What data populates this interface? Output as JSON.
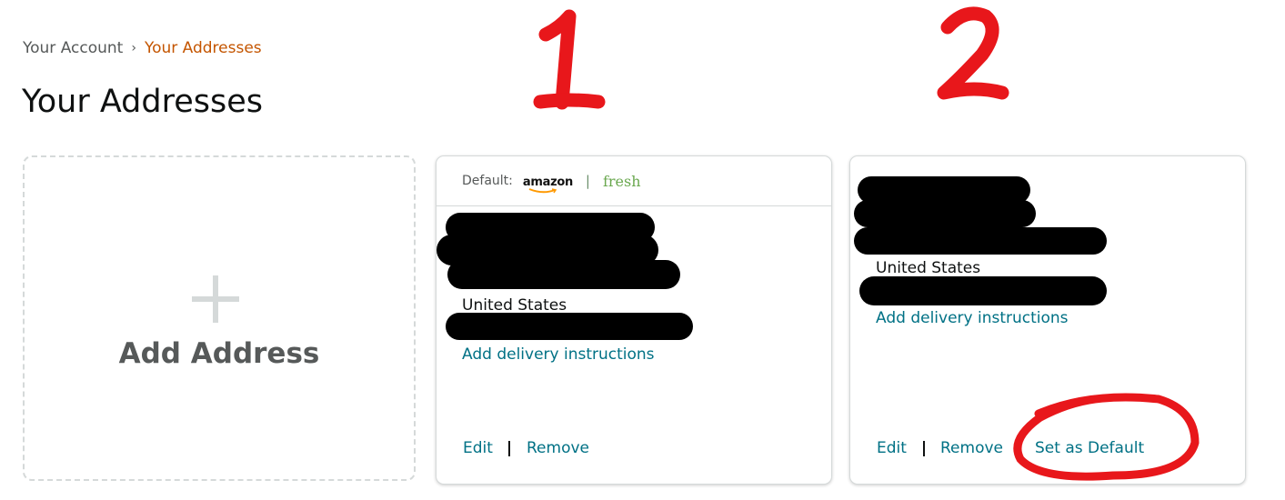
{
  "breadcrumb": {
    "parent": "Your Account",
    "separator": "›",
    "current": "Your Addresses"
  },
  "page_title": "Your Addresses",
  "add_card": {
    "icon": "plus-icon",
    "label": "Add Address"
  },
  "addresses": [
    {
      "default_label": "Default:",
      "brand_logos": [
        "amazon",
        "fresh"
      ],
      "logo_separator": "|",
      "country": "United States",
      "delivery_link": "Add delivery instructions",
      "edit": "Edit",
      "remove": "Remove"
    },
    {
      "country": "United States",
      "delivery_link": "Add delivery instructions",
      "edit": "Edit",
      "remove": "Remove",
      "set_default": "Set as Default"
    }
  ],
  "annotations": {
    "label_1": "1",
    "label_2": "2",
    "color": "#e8171b"
  },
  "colors": {
    "link": "#007185",
    "breadcrumb_current": "#c45500",
    "redaction": "#000000"
  }
}
